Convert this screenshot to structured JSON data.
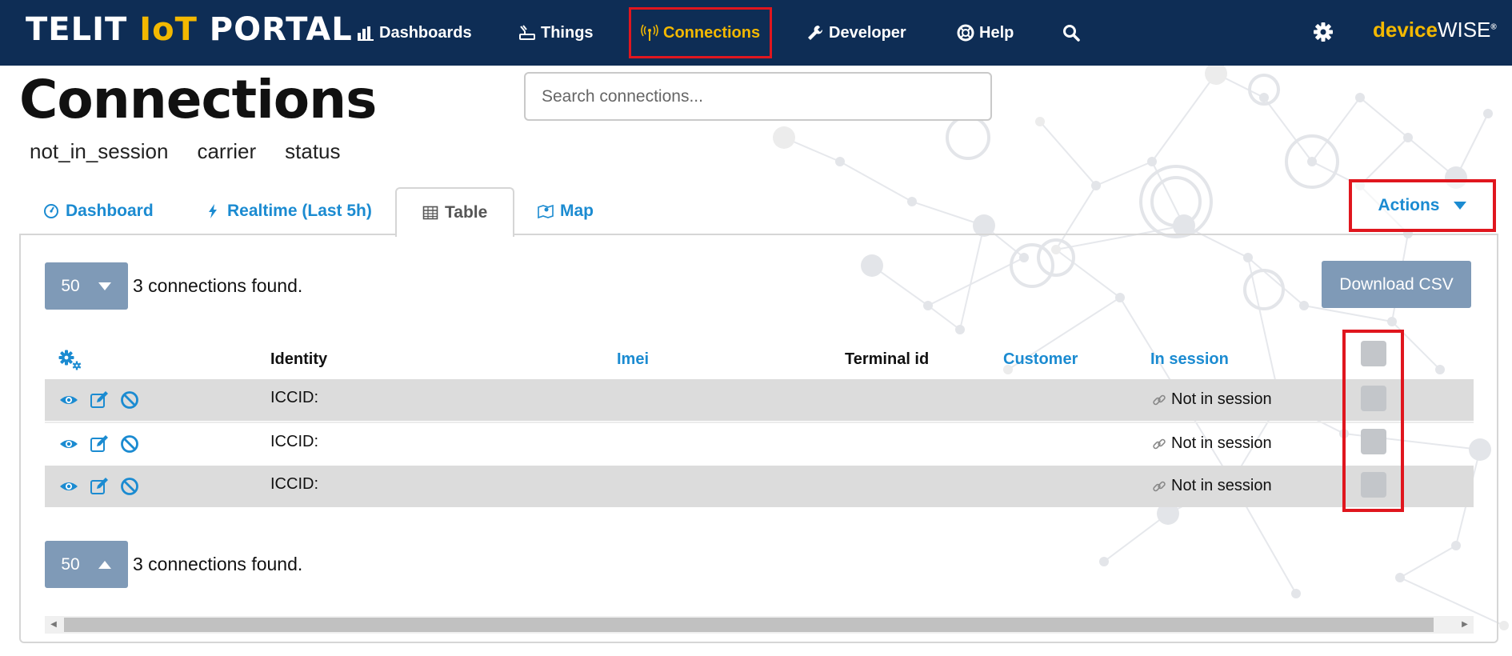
{
  "nav": {
    "brand_prefix": "TELIT ",
    "brand_iot": "IoT",
    "brand_suffix": " PORTAL",
    "items": [
      {
        "label": "Dashboards",
        "icon": "bar-chart-icon"
      },
      {
        "label": "Things",
        "icon": "thing-icon"
      },
      {
        "label": "Connections",
        "icon": "antenna-icon",
        "active": true
      },
      {
        "label": "Developer",
        "icon": "wrench-icon"
      },
      {
        "label": "Help",
        "icon": "lifebuoy-icon"
      }
    ],
    "device_brand": "device",
    "device_brand_wise": "WISE",
    "device_brand_mark": "®"
  },
  "page": {
    "title": "Connections",
    "search_placeholder": "Search connections...",
    "filters": [
      "not_in_session",
      "carrier",
      "status"
    ]
  },
  "tabs": [
    {
      "label": "Dashboard",
      "icon": "dashboard-gauge-icon"
    },
    {
      "label": "Realtime (Last 5h)",
      "icon": "bolt-icon"
    },
    {
      "label": "Table",
      "icon": "table-icon",
      "active": true
    },
    {
      "label": "Map",
      "icon": "map-icon"
    }
  ],
  "actions_label": "Actions",
  "pager": {
    "page_size": "50",
    "found_text": "3 connections found.",
    "download_label": "Download CSV"
  },
  "table": {
    "columns": [
      {
        "label": "Identity",
        "sortable": false
      },
      {
        "label": "Imei",
        "sortable": true
      },
      {
        "label": "Terminal id",
        "sortable": false
      },
      {
        "label": "Customer",
        "sortable": true
      },
      {
        "label": "In session",
        "sortable": true
      }
    ],
    "rows": [
      {
        "identity": "ICCID:",
        "in_session": "Not in session"
      },
      {
        "identity": "ICCID:",
        "in_session": "Not in session"
      },
      {
        "identity": "ICCID:",
        "in_session": "Not in session"
      }
    ]
  },
  "colors": {
    "nav_bg": "#0e2d55",
    "accent_yellow": "#f3b800",
    "link_blue": "#1b8bd1",
    "button_gray_blue": "#7f9ab7",
    "highlight_red": "#e0161e"
  }
}
